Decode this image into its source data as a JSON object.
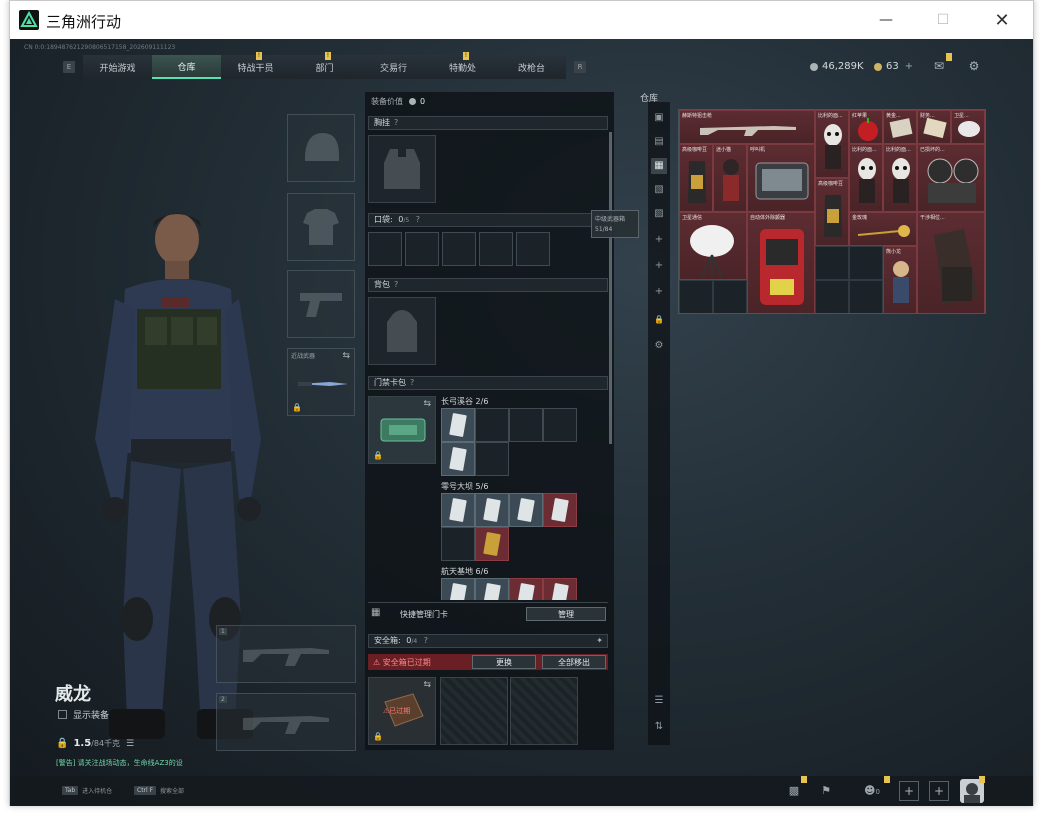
{
  "window": {
    "title": "三角洲行动"
  },
  "session_id": "CN 0:0:1894876212908065171​58_2026091111​23",
  "nav": {
    "prev_key": "E",
    "next_key": "R",
    "tabs": [
      {
        "label": "开始游戏",
        "badge": false
      },
      {
        "label": "仓库",
        "badge": false,
        "active": true
      },
      {
        "label": "特战干员",
        "badge": true
      },
      {
        "label": "部门",
        "badge": true
      },
      {
        "label": "交易行",
        "badge": false
      },
      {
        "label": "特勤处",
        "badge": true
      },
      {
        "label": "改枪台",
        "badge": false
      }
    ]
  },
  "currency": {
    "silver": "46,289K",
    "gold": "63",
    "plus": "+"
  },
  "character": {
    "name": "威龙",
    "show_equipment": "显示装备",
    "weight_value": "1.5",
    "weight_cap": "/84千克",
    "ticker": "[警告] 请关注战场动态，生命线AZ3的设"
  },
  "slots": {
    "melee_label": "近战武器",
    "weapon1_index": "1",
    "weapon2_index": "2"
  },
  "equipment": {
    "value_label": "装备价值",
    "value": "0",
    "chest_rig": "胸挂",
    "pockets": "口袋:",
    "pockets_count": "0",
    "pockets_cap": "/5",
    "backpack": "背包",
    "keycard_bag": "门禁卡包",
    "tooltip_title": "中级武器箱",
    "tooltip_value": "51/84",
    "maps": [
      {
        "name": "长弓溪谷",
        "count": "2/6"
      },
      {
        "name": "零号大坝",
        "count": "5/6"
      },
      {
        "name": "航天基地",
        "count": "6/6"
      }
    ],
    "quick_manage": "快捷管理门卡",
    "manage_btn": "管理",
    "safe_box": "安全箱:",
    "safe_count": "0",
    "safe_cap": "/4",
    "safe_expired": "安全箱已过期",
    "replace_btn": "更换",
    "move_all_btn": "全部移出",
    "expired_tag": "已过期"
  },
  "warehouse": {
    "title": "仓库",
    "items": [
      {
        "label": "赫斯特狙击枪"
      },
      {
        "label": "比利的面..."
      },
      {
        "label": "红苹果"
      },
      {
        "label": "黄金..."
      },
      {
        "label": "财务..."
      },
      {
        "label": "卫星..."
      },
      {
        "label": "高级咖啡豆"
      },
      {
        "label": "迷小猫"
      },
      {
        "label": "呼叫机"
      },
      {
        "label": "比利的面..."
      },
      {
        "label": "比利的面..."
      },
      {
        "label": "比利的面..."
      },
      {
        "label": "已损坏的..."
      },
      {
        "label": "高级咖啡豆"
      },
      {
        "label": "卫星通信"
      },
      {
        "label": "自动体外除颤器"
      },
      {
        "label": "金玫瑰"
      },
      {
        "label": "干涉相位..."
      },
      {
        "label": "熊小龙"
      }
    ]
  },
  "bottom": {
    "hint1_key": "Tab",
    "hint1": "进入待机仓",
    "hint2_key": "Ctrl F",
    "hint2": "搜索全部",
    "friends_count": "0"
  }
}
